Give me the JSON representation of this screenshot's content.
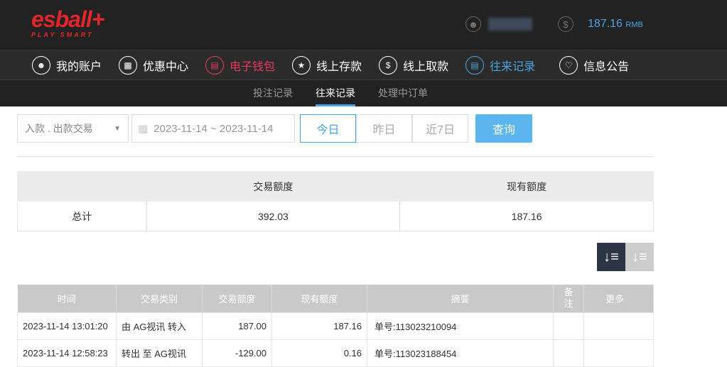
{
  "brand": {
    "logo": "esball+",
    "tagline": "PLAY SMART"
  },
  "header": {
    "balance": "187.16",
    "currency": "RMB"
  },
  "nav": [
    {
      "label": "我的账户",
      "icon": "user-icon"
    },
    {
      "label": "优惠中心",
      "icon": "gift-icon"
    },
    {
      "label": "电子钱包",
      "icon": "wallet-icon"
    },
    {
      "label": "线上存款",
      "icon": "deposit-icon"
    },
    {
      "label": "线上取款",
      "icon": "withdraw-icon"
    },
    {
      "label": "往来记录",
      "icon": "records-icon"
    },
    {
      "label": "信息公告",
      "icon": "bell-icon"
    }
  ],
  "subnav": [
    "投注记录",
    "往来记录",
    "处理中订单"
  ],
  "filters": {
    "type": "入款 . 出款交易",
    "date_range": "2023-11-14 ~ 2023-11-14",
    "ranges": [
      "今日",
      "昨日",
      "近7日"
    ],
    "query": "查询"
  },
  "summary": {
    "headers": [
      "",
      "交易额度",
      "现有额度"
    ],
    "row": [
      "总计",
      "392.03",
      "187.16"
    ]
  },
  "table": {
    "headers": [
      "时间",
      "交易类别",
      "交易额度",
      "现有额度",
      "摘要",
      "备注",
      "更多"
    ],
    "rows": [
      [
        "2023-11-14 13:01:20",
        "由 AG视讯 转入",
        "187.00",
        "187.16",
        "单号:113023210094",
        "",
        ""
      ],
      [
        "2023-11-14 12:58:23",
        "转出 至 AG视讯",
        "-129.00",
        "0.16",
        "单号:113023188454",
        "",
        ""
      ]
    ]
  },
  "colors": {
    "accent": "#4ba3e0",
    "active_red": "#e43a60",
    "logo": "#e0262b"
  }
}
